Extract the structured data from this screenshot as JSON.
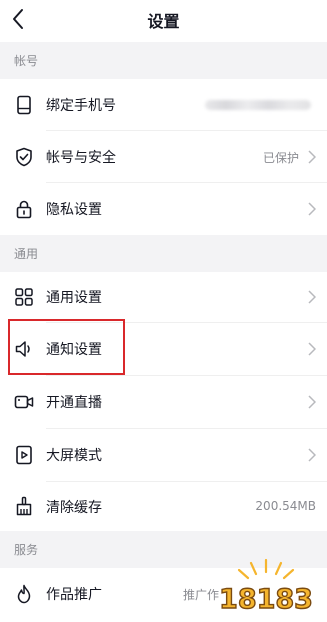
{
  "header": {
    "title": "设置"
  },
  "sections": [
    {
      "title": "帐号",
      "items": [
        {
          "label": "绑定手机号",
          "icon": "phone-icon",
          "value": "",
          "value_blurred": true
        },
        {
          "label": "帐号与安全",
          "icon": "shield-check-icon",
          "value": "已保护"
        },
        {
          "label": "隐私设置",
          "icon": "lock-icon",
          "value": ""
        }
      ]
    },
    {
      "title": "通用",
      "items": [
        {
          "label": "通用设置",
          "icon": "grid-icon",
          "value": ""
        },
        {
          "label": "通知设置",
          "icon": "speaker-icon",
          "value": "",
          "highlighted": true
        },
        {
          "label": "开通直播",
          "icon": "video-camera-icon",
          "value": ""
        },
        {
          "label": "大屏模式",
          "icon": "play-screen-icon",
          "value": ""
        },
        {
          "label": "清除缓存",
          "icon": "broom-icon",
          "value": "200.54MB"
        }
      ]
    },
    {
      "title": "服务",
      "items": [
        {
          "label": "作品推广",
          "icon": "flame-icon",
          "value": "推广作"
        }
      ]
    }
  ],
  "watermark": {
    "text": "18183"
  },
  "colors": {
    "highlight": "#d9282b",
    "section_bg": "#f3f3f5",
    "watermark": "#f5b52e"
  }
}
